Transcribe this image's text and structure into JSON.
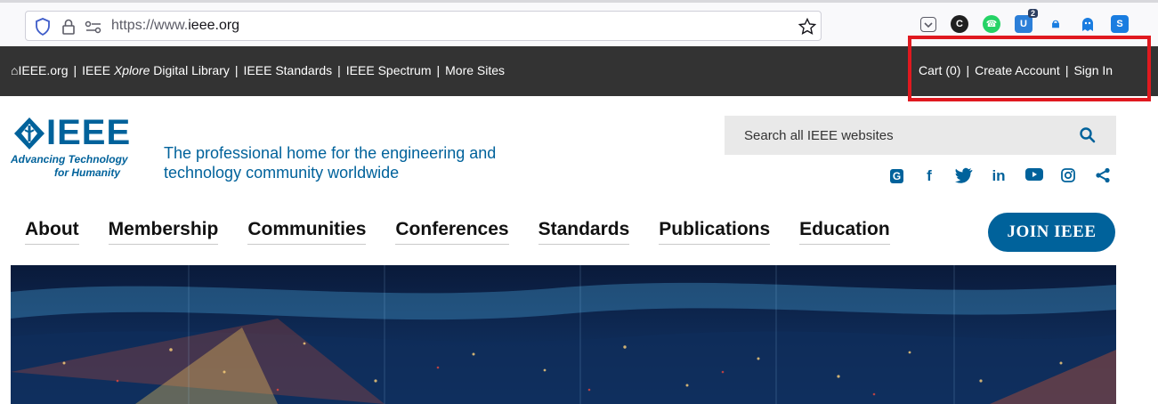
{
  "browser": {
    "url_prefix": "https://www.",
    "url_domain": "ieee.org",
    "extensions": [
      {
        "name": "pocket-icon",
        "color": "#ffffff"
      },
      {
        "name": "extension-c-icon",
        "color": "#202020"
      },
      {
        "name": "whatsapp-icon",
        "color": "#25d366"
      },
      {
        "name": "ublock-icon",
        "color": "#2c7fd8",
        "badge": "2"
      },
      {
        "name": "lock-extension-icon",
        "color": "#1a7de0"
      },
      {
        "name": "ghost-icon",
        "color": "#1a7de0"
      },
      {
        "name": "s-extension-icon",
        "color": "#1a7de0"
      }
    ]
  },
  "metabar": {
    "home": "IEEE.org",
    "xplore_prefix": "IEEE ",
    "xplore_italic": "Xplore",
    "xplore_suffix": " Digital Library",
    "standards": "IEEE Standards",
    "spectrum": "IEEE Spectrum",
    "more": "More Sites",
    "cart": "Cart (0)",
    "create_account": "Create Account",
    "sign_in": "Sign In",
    "separator": "|"
  },
  "header": {
    "logo_word": "IEEE",
    "logo_tag_1": "Advancing Technology",
    "logo_tag_2": "for Humanity",
    "tagline_1": "The professional home for the engineering and",
    "tagline_2": "technology community worldwide",
    "search_placeholder": "Search all IEEE websites"
  },
  "nav": {
    "items": [
      "About",
      "Membership",
      "Communities",
      "Conferences",
      "Standards",
      "Publications",
      "Education"
    ],
    "join": "JOIN IEEE"
  },
  "colors": {
    "brand": "#00629b",
    "metabar": "#333333",
    "highlight": "#e0191f"
  }
}
